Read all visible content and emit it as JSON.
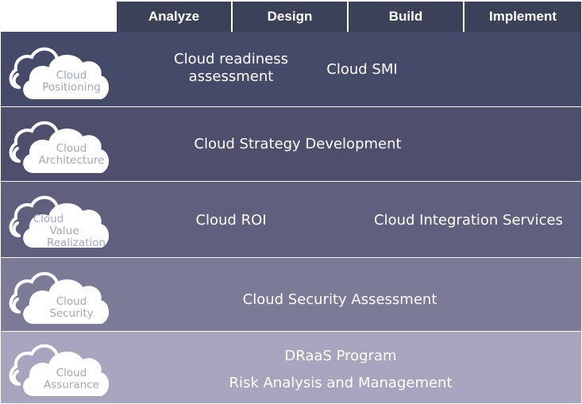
{
  "phases": [
    "Analyze",
    "Design",
    "Build",
    "Implement"
  ],
  "rows": [
    {
      "cloud_label": [
        "Cloud",
        "Positioning"
      ],
      "activities": [
        "Cloud readiness\nassessment",
        "Cloud SMI"
      ]
    },
    {
      "cloud_label": [
        "Cloud",
        "Architecture"
      ],
      "activities": [
        "Cloud Strategy Development"
      ]
    },
    {
      "cloud_label": [
        "Cloud",
        "Value",
        "Realization"
      ],
      "activities": [
        "Cloud ROI",
        "Cloud Integration Services"
      ]
    },
    {
      "cloud_label": [
        "Cloud",
        "Security"
      ],
      "activities": [
        "Cloud Security Assessment"
      ]
    },
    {
      "cloud_label": [
        "Cloud",
        "Assurance"
      ],
      "activities": [
        "DRaaS Program",
        "Risk Analysis and Management"
      ]
    }
  ],
  "colors": {
    "header": "#3b4258",
    "row_1": "#454a68",
    "row_2": "#4d4f6c",
    "row_3": "#5f607d",
    "row_4": "#7b7b97",
    "row_5": "#a7a5bd",
    "cloud_fill": "#ffffff",
    "cloud_text": "#a2a6bb"
  },
  "icons": [
    "cloud-icon"
  ]
}
